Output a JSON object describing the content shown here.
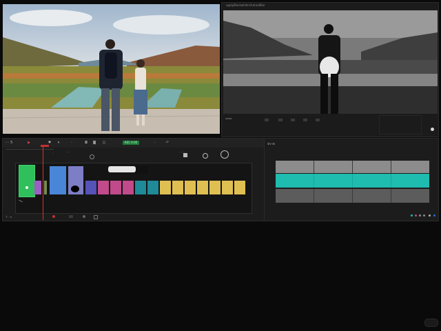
{
  "viewer": {
    "title": "applyBlackwhite·OutrealBlur"
  },
  "scopes": {
    "label": "ᗫᐯ ᘚ"
  },
  "timeline": {
    "toolbar_labels": [
      "◦◦ 5",
      "REC 0:00"
    ],
    "status_label": "ᒣ◦ ≡",
    "track_labels": [
      "◦",
      "◦◦ᐧ",
      "◦◦◦◦"
    ]
  },
  "colors": {
    "accent_green": "#2fbf5b",
    "clip_blue": "#4a86d8",
    "clip_lavender": "#7e7ec6",
    "clip_indigo": "#5552b8",
    "clip_magenta": "#c04a8a",
    "clip_teal": "#1f8a98",
    "clip_yellow": "#e0bf52",
    "scope_teal": "#1fbcb0",
    "scope_grey": "#8c8c8c"
  },
  "icons": [
    "play-icon",
    "marker-icon",
    "razor-icon",
    "link-icon",
    "undo-icon",
    "audio-icon",
    "fullscreen-icon",
    "video-icon"
  ]
}
